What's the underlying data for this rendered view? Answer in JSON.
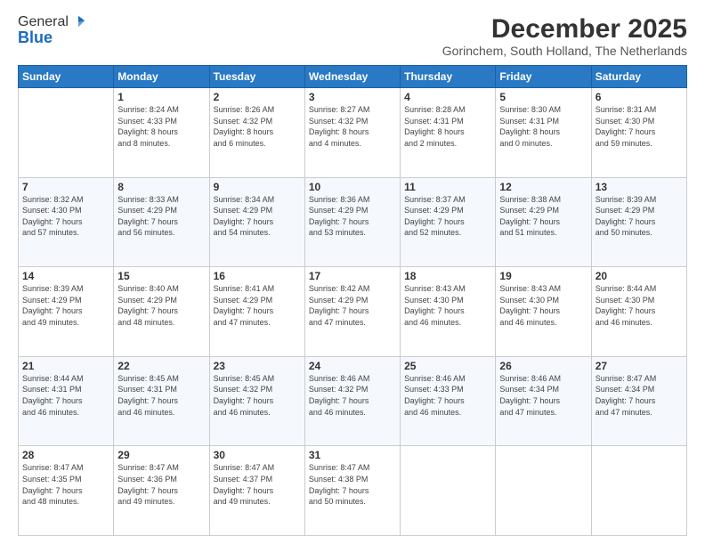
{
  "logo": {
    "line1": "General",
    "line2": "Blue"
  },
  "header": {
    "title": "December 2025",
    "subtitle": "Gorinchem, South Holland, The Netherlands"
  },
  "columns": [
    "Sunday",
    "Monday",
    "Tuesday",
    "Wednesday",
    "Thursday",
    "Friday",
    "Saturday"
  ],
  "weeks": [
    [
      {
        "day": "",
        "info": ""
      },
      {
        "day": "1",
        "info": "Sunrise: 8:24 AM\nSunset: 4:33 PM\nDaylight: 8 hours\nand 8 minutes."
      },
      {
        "day": "2",
        "info": "Sunrise: 8:26 AM\nSunset: 4:32 PM\nDaylight: 8 hours\nand 6 minutes."
      },
      {
        "day": "3",
        "info": "Sunrise: 8:27 AM\nSunset: 4:32 PM\nDaylight: 8 hours\nand 4 minutes."
      },
      {
        "day": "4",
        "info": "Sunrise: 8:28 AM\nSunset: 4:31 PM\nDaylight: 8 hours\nand 2 minutes."
      },
      {
        "day": "5",
        "info": "Sunrise: 8:30 AM\nSunset: 4:31 PM\nDaylight: 8 hours\nand 0 minutes."
      },
      {
        "day": "6",
        "info": "Sunrise: 8:31 AM\nSunset: 4:30 PM\nDaylight: 7 hours\nand 59 minutes."
      }
    ],
    [
      {
        "day": "7",
        "info": "Sunrise: 8:32 AM\nSunset: 4:30 PM\nDaylight: 7 hours\nand 57 minutes."
      },
      {
        "day": "8",
        "info": "Sunrise: 8:33 AM\nSunset: 4:29 PM\nDaylight: 7 hours\nand 56 minutes."
      },
      {
        "day": "9",
        "info": "Sunrise: 8:34 AM\nSunset: 4:29 PM\nDaylight: 7 hours\nand 54 minutes."
      },
      {
        "day": "10",
        "info": "Sunrise: 8:36 AM\nSunset: 4:29 PM\nDaylight: 7 hours\nand 53 minutes."
      },
      {
        "day": "11",
        "info": "Sunrise: 8:37 AM\nSunset: 4:29 PM\nDaylight: 7 hours\nand 52 minutes."
      },
      {
        "day": "12",
        "info": "Sunrise: 8:38 AM\nSunset: 4:29 PM\nDaylight: 7 hours\nand 51 minutes."
      },
      {
        "day": "13",
        "info": "Sunrise: 8:39 AM\nSunset: 4:29 PM\nDaylight: 7 hours\nand 50 minutes."
      }
    ],
    [
      {
        "day": "14",
        "info": "Sunrise: 8:39 AM\nSunset: 4:29 PM\nDaylight: 7 hours\nand 49 minutes."
      },
      {
        "day": "15",
        "info": "Sunrise: 8:40 AM\nSunset: 4:29 PM\nDaylight: 7 hours\nand 48 minutes."
      },
      {
        "day": "16",
        "info": "Sunrise: 8:41 AM\nSunset: 4:29 PM\nDaylight: 7 hours\nand 47 minutes."
      },
      {
        "day": "17",
        "info": "Sunrise: 8:42 AM\nSunset: 4:29 PM\nDaylight: 7 hours\nand 47 minutes."
      },
      {
        "day": "18",
        "info": "Sunrise: 8:43 AM\nSunset: 4:30 PM\nDaylight: 7 hours\nand 46 minutes."
      },
      {
        "day": "19",
        "info": "Sunrise: 8:43 AM\nSunset: 4:30 PM\nDaylight: 7 hours\nand 46 minutes."
      },
      {
        "day": "20",
        "info": "Sunrise: 8:44 AM\nSunset: 4:30 PM\nDaylight: 7 hours\nand 46 minutes."
      }
    ],
    [
      {
        "day": "21",
        "info": "Sunrise: 8:44 AM\nSunset: 4:31 PM\nDaylight: 7 hours\nand 46 minutes."
      },
      {
        "day": "22",
        "info": "Sunrise: 8:45 AM\nSunset: 4:31 PM\nDaylight: 7 hours\nand 46 minutes."
      },
      {
        "day": "23",
        "info": "Sunrise: 8:45 AM\nSunset: 4:32 PM\nDaylight: 7 hours\nand 46 minutes."
      },
      {
        "day": "24",
        "info": "Sunrise: 8:46 AM\nSunset: 4:32 PM\nDaylight: 7 hours\nand 46 minutes."
      },
      {
        "day": "25",
        "info": "Sunrise: 8:46 AM\nSunset: 4:33 PM\nDaylight: 7 hours\nand 46 minutes."
      },
      {
        "day": "26",
        "info": "Sunrise: 8:46 AM\nSunset: 4:34 PM\nDaylight: 7 hours\nand 47 minutes."
      },
      {
        "day": "27",
        "info": "Sunrise: 8:47 AM\nSunset: 4:34 PM\nDaylight: 7 hours\nand 47 minutes."
      }
    ],
    [
      {
        "day": "28",
        "info": "Sunrise: 8:47 AM\nSunset: 4:35 PM\nDaylight: 7 hours\nand 48 minutes."
      },
      {
        "day": "29",
        "info": "Sunrise: 8:47 AM\nSunset: 4:36 PM\nDaylight: 7 hours\nand 49 minutes."
      },
      {
        "day": "30",
        "info": "Sunrise: 8:47 AM\nSunset: 4:37 PM\nDaylight: 7 hours\nand 49 minutes."
      },
      {
        "day": "31",
        "info": "Sunrise: 8:47 AM\nSunset: 4:38 PM\nDaylight: 7 hours\nand 50 minutes."
      },
      {
        "day": "",
        "info": ""
      },
      {
        "day": "",
        "info": ""
      },
      {
        "day": "",
        "info": ""
      }
    ]
  ]
}
